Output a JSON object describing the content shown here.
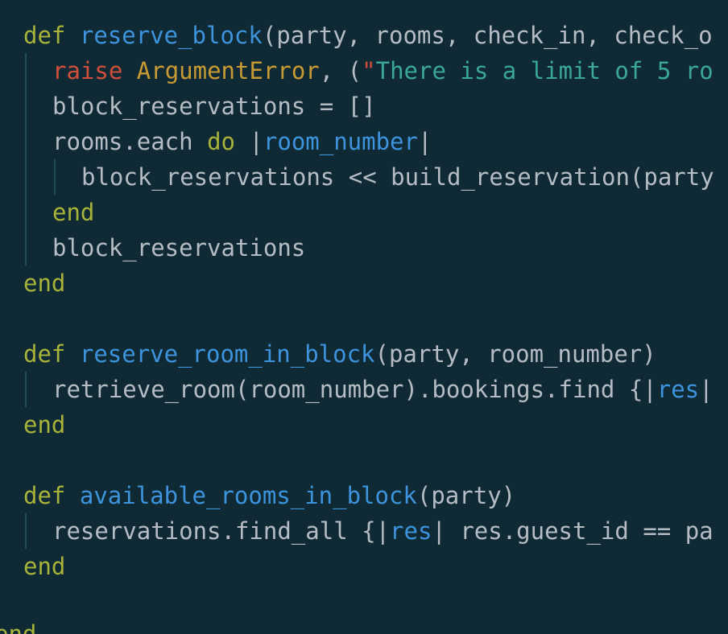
{
  "code": {
    "lines": [
      [
        {
          "t": "def",
          "c": "kw"
        },
        {
          "t": " ",
          "c": "txt"
        },
        {
          "t": "reserve_block",
          "c": "fn"
        },
        {
          "t": "(party, rooms, check_in, check_o",
          "c": "txt"
        }
      ],
      [
        {
          "t": "raise",
          "c": "raise"
        },
        {
          "t": " ",
          "c": "txt"
        },
        {
          "t": "ArgumentError",
          "c": "cls"
        },
        {
          "t": ", (",
          "c": "txt"
        },
        {
          "t": "\"",
          "c": "raise"
        },
        {
          "t": "There is a limit of 5 ro",
          "c": "str"
        }
      ],
      [
        {
          "t": "block_reservations = []",
          "c": "txt"
        }
      ],
      [
        {
          "t": "rooms.each ",
          "c": "txt"
        },
        {
          "t": "do",
          "c": "kw"
        },
        {
          "t": " |",
          "c": "txt"
        },
        {
          "t": "room_number",
          "c": "var"
        },
        {
          "t": "|",
          "c": "txt"
        }
      ],
      [
        {
          "t": "block_reservations << build_reservation(party",
          "c": "txt"
        }
      ],
      [
        {
          "t": "end",
          "c": "kw"
        }
      ],
      [
        {
          "t": "block_reservations",
          "c": "txt"
        }
      ],
      [
        {
          "t": "end",
          "c": "kw"
        }
      ],
      [],
      [
        {
          "t": "def",
          "c": "kw"
        },
        {
          "t": " ",
          "c": "txt"
        },
        {
          "t": "reserve_room_in_block",
          "c": "fn"
        },
        {
          "t": "(party, room_number)",
          "c": "txt"
        }
      ],
      [
        {
          "t": "retrieve_room(room_number).bookings.find {|",
          "c": "txt"
        },
        {
          "t": "res",
          "c": "var"
        },
        {
          "t": "|",
          "c": "txt"
        }
      ],
      [
        {
          "t": "end",
          "c": "kw"
        }
      ],
      [],
      [
        {
          "t": "def",
          "c": "kw"
        },
        {
          "t": " ",
          "c": "txt"
        },
        {
          "t": "available_rooms_in_block",
          "c": "fn"
        },
        {
          "t": "(party)",
          "c": "txt"
        }
      ],
      [
        {
          "t": "reservations.find_all {|",
          "c": "txt"
        },
        {
          "t": "res",
          "c": "var"
        },
        {
          "t": "| res.guest_id == pa",
          "c": "txt"
        }
      ],
      [
        {
          "t": "end",
          "c": "kw"
        }
      ],
      [],
      [
        {
          "t": "end",
          "c": "kw"
        }
      ]
    ]
  },
  "colors": {
    "background": "#0f2a34",
    "text": "#b6bcc4",
    "keyword": "#a7b33a",
    "function": "#3d93dc",
    "raise": "#d04e3b",
    "class": "#c89a34",
    "string": "#3aa79a",
    "block_variable": "#3d93dc",
    "indent_guide": "#1f4a57"
  }
}
